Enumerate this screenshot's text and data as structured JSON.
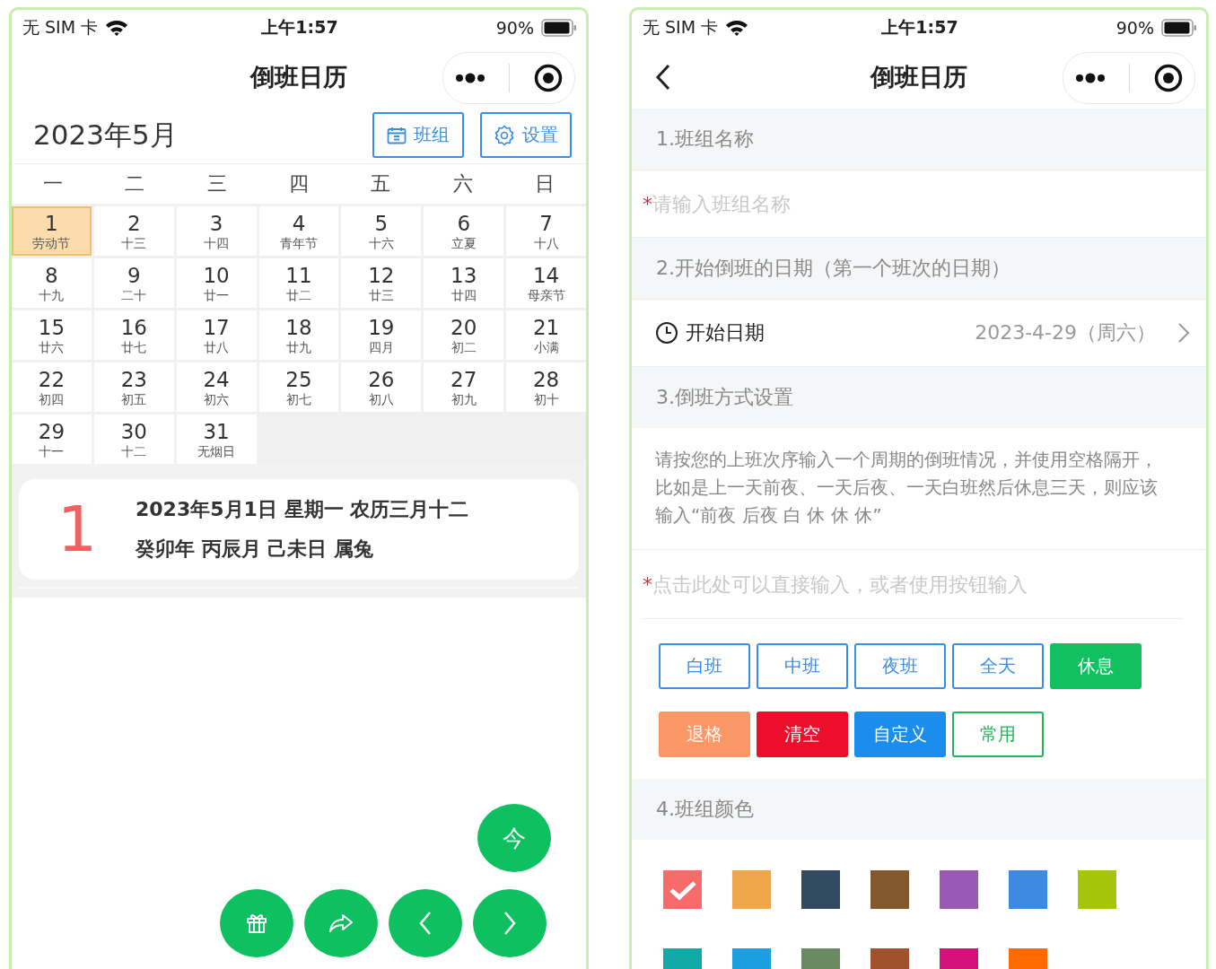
{
  "calendar_screen": {
    "status_bar": {
      "carrier": "无 SIM 卡",
      "time": "上午1:57",
      "battery": "90%"
    },
    "nav": {
      "title": "倒班日历"
    },
    "header": {
      "month": "2023年5月",
      "buttons": [
        {
          "label": "班组",
          "kind": "calendar"
        },
        {
          "label": "设置",
          "kind": "gear"
        }
      ]
    },
    "weekdays": [
      "一",
      "二",
      "三",
      "四",
      "五",
      "六",
      "日"
    ],
    "days": [
      {
        "day": "1",
        "lunar": "劳动节",
        "selected": true
      },
      {
        "day": "2",
        "lunar": "十三",
        "selected": false
      },
      {
        "day": "3",
        "lunar": "十四",
        "selected": false
      },
      {
        "day": "4",
        "lunar": "青年节",
        "selected": false
      },
      {
        "day": "5",
        "lunar": "十六",
        "selected": false
      },
      {
        "day": "6",
        "lunar": "立夏",
        "selected": false
      },
      {
        "day": "7",
        "lunar": "十八",
        "selected": false
      },
      {
        "day": "8",
        "lunar": "十九",
        "selected": false
      },
      {
        "day": "9",
        "lunar": "二十",
        "selected": false
      },
      {
        "day": "10",
        "lunar": "廿一",
        "selected": false
      },
      {
        "day": "11",
        "lunar": "廿二",
        "selected": false
      },
      {
        "day": "12",
        "lunar": "廿三",
        "selected": false
      },
      {
        "day": "13",
        "lunar": "廿四",
        "selected": false
      },
      {
        "day": "14",
        "lunar": "母亲节",
        "selected": false
      },
      {
        "day": "15",
        "lunar": "廿六",
        "selected": false
      },
      {
        "day": "16",
        "lunar": "廿七",
        "selected": false
      },
      {
        "day": "17",
        "lunar": "廿八",
        "selected": false
      },
      {
        "day": "18",
        "lunar": "廿九",
        "selected": false
      },
      {
        "day": "19",
        "lunar": "四月",
        "selected": false
      },
      {
        "day": "20",
        "lunar": "初二",
        "selected": false
      },
      {
        "day": "21",
        "lunar": "小满",
        "selected": false
      },
      {
        "day": "22",
        "lunar": "初四",
        "selected": false
      },
      {
        "day": "23",
        "lunar": "初五",
        "selected": false
      },
      {
        "day": "24",
        "lunar": "初六",
        "selected": false
      },
      {
        "day": "25",
        "lunar": "初七",
        "selected": false
      },
      {
        "day": "26",
        "lunar": "初八",
        "selected": false
      },
      {
        "day": "27",
        "lunar": "初九",
        "selected": false
      },
      {
        "day": "28",
        "lunar": "初十",
        "selected": false
      },
      {
        "day": "29",
        "lunar": "十一",
        "selected": false
      },
      {
        "day": "30",
        "lunar": "十二",
        "selected": false
      },
      {
        "day": "31",
        "lunar": "无烟日",
        "selected": false
      }
    ],
    "detail": {
      "day": "1",
      "line_1": "2023年5月1日 星期一 农历三月十二",
      "line_2": "癸卯年 丙辰月 己未日 属兔"
    },
    "today_button": "今",
    "fab_buttons": [
      {
        "kind": "gift"
      },
      {
        "kind": "share"
      },
      {
        "kind": "prev"
      },
      {
        "kind": "next"
      }
    ]
  },
  "settings_screen": {
    "status_bar": {
      "carrier": "无 SIM 卡",
      "time": "上午1:57",
      "battery": "90%"
    },
    "nav": {
      "title": "倒班日历"
    },
    "section_1": {
      "title": "1.班组名称",
      "mark": "*",
      "placeholder": "请输入班组名称"
    },
    "section_2": {
      "title": "2.开始倒班的日期（第一个班次的日期）",
      "label": "开始日期",
      "value": "2023-4-29（周六）"
    },
    "section_3": {
      "title": "3.倒班方式设置",
      "description": "请按您的上班次序输入一个周期的倒班情况，并使用空格隔开，比如是上一天前夜、一天后夜、一天白班然后休息三天，则应该输入“前夜 后夜 白 休 休 休”",
      "mark": "*",
      "placeholder": "点击此处可以直接输入，或者使用按钮输入",
      "buttons": [
        {
          "label": "白班",
          "kind": "outline",
          "color": "#3a8ee6"
        },
        {
          "label": "中班",
          "kind": "outline",
          "color": "#3a8ee6"
        },
        {
          "label": "夜班",
          "kind": "outline",
          "color": "#3a8ee6"
        },
        {
          "label": "全天",
          "kind": "outline",
          "color": "#3a8ee6"
        },
        {
          "label": "休息",
          "kind": "filled",
          "color": "#12c060"
        },
        {
          "label": "退格",
          "kind": "filled",
          "color": "#fb9868"
        },
        {
          "label": "清空",
          "kind": "filled",
          "color": "#ec0e2a"
        },
        {
          "label": "自定义",
          "kind": "filled",
          "color": "#1b8ded"
        },
        {
          "label": "常用",
          "kind": "outline",
          "color": "#22b55a"
        }
      ]
    },
    "section_4": {
      "title": "4.班组颜色",
      "swatches": [
        {
          "color": "#f76b6b",
          "selected": true
        },
        {
          "color": "#f0a64b",
          "selected": false
        },
        {
          "color": "#324a5f",
          "selected": false
        },
        {
          "color": "#83592c",
          "selected": false
        },
        {
          "color": "#9b59b6",
          "selected": false
        },
        {
          "color": "#3d8ae2",
          "selected": false
        },
        {
          "color": "#a5c40c",
          "selected": false
        },
        {
          "color": "#11a8a8",
          "selected": false
        },
        {
          "color": "#1b9fe0",
          "selected": false
        },
        {
          "color": "#6a8a62",
          "selected": false
        },
        {
          "color": "#a0522d",
          "selected": false
        },
        {
          "color": "#d4107a",
          "selected": false
        },
        {
          "color": "#ff6a00",
          "selected": false
        }
      ]
    }
  }
}
